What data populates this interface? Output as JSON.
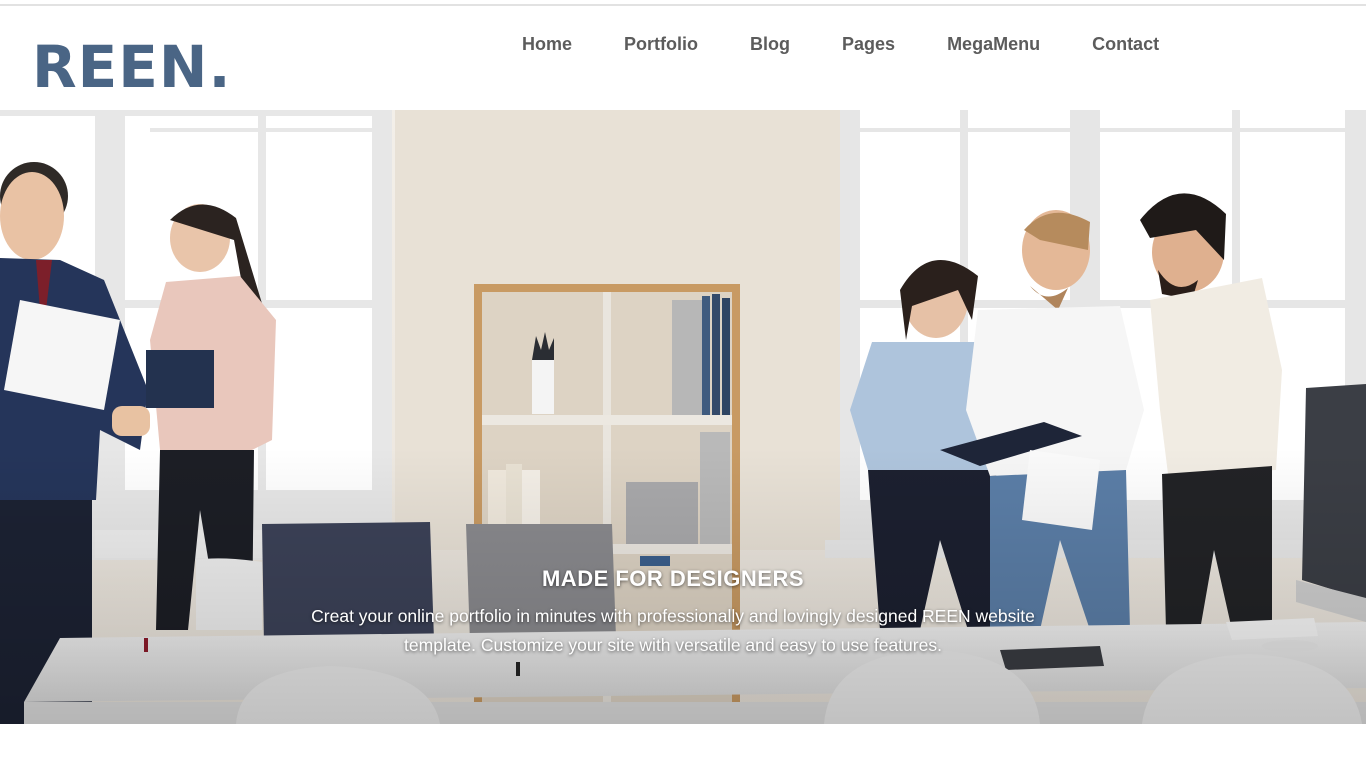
{
  "brand": {
    "logo": "REEN.",
    "color": "#4a6585"
  },
  "nav": {
    "items": [
      {
        "label": "Home"
      },
      {
        "label": "Portfolio"
      },
      {
        "label": "Blog"
      },
      {
        "label": "Pages"
      },
      {
        "label": "MegaMenu"
      },
      {
        "label": "Contact"
      }
    ]
  },
  "hero": {
    "title": "MADE FOR DESIGNERS",
    "text": "Creat your online portfolio in minutes with professionally and lovingly designed REEN website template. Customize your site with versatile and easy to use features."
  }
}
